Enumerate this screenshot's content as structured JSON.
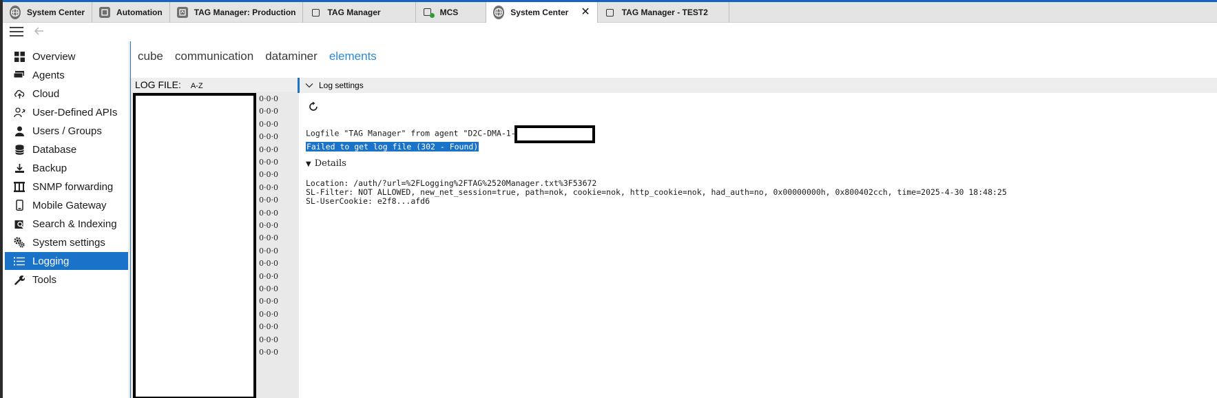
{
  "tabs": [
    {
      "label": "System Center",
      "icon": "globe-icon",
      "active": false
    },
    {
      "label": "Automation",
      "icon": "app-icon",
      "active": false
    },
    {
      "label": "TAG Manager: Production",
      "icon": "app-icon",
      "active": false
    },
    {
      "label": "TAG Manager",
      "icon": "square-icon",
      "active": false
    },
    {
      "label": "MCS",
      "icon": "square-status-icon",
      "active": false
    },
    {
      "label": "System Center",
      "icon": "globe-icon",
      "active": true
    },
    {
      "label": "TAG Manager - TEST2",
      "icon": "square-icon",
      "active": false
    }
  ],
  "tab_close_glyph": "✕",
  "sidebar": {
    "items": [
      {
        "label": "Overview",
        "icon": "grid-icon"
      },
      {
        "label": "Agents",
        "icon": "agents-icon"
      },
      {
        "label": "Cloud",
        "icon": "cloud-upload-icon"
      },
      {
        "label": "User-Defined APIs",
        "icon": "api-user-icon"
      },
      {
        "label": "Users / Groups",
        "icon": "user-icon"
      },
      {
        "label": "Database",
        "icon": "database-icon"
      },
      {
        "label": "Backup",
        "icon": "backup-icon"
      },
      {
        "label": "SNMP forwarding",
        "icon": "snmp-icon"
      },
      {
        "label": "Mobile Gateway",
        "icon": "mobile-icon"
      },
      {
        "label": "Search & Indexing",
        "icon": "search-index-icon"
      },
      {
        "label": "System settings",
        "icon": "gears-icon"
      },
      {
        "label": "Logging",
        "icon": "list-icon",
        "active": true
      },
      {
        "label": "Tools",
        "icon": "wrench-icon"
      }
    ]
  },
  "topnav": {
    "items": [
      "cube",
      "communication",
      "dataminer",
      "elements"
    ],
    "active": "elements"
  },
  "logfile": {
    "title": "LOG FILE:",
    "sort_label": "A-Z",
    "row_value": "0·0·0",
    "row_count": 21
  },
  "settings": {
    "header": "Log settings",
    "logfile_line": "Logfile \"TAG Manager\" from agent \"D2C-DMA-1-",
    "error": "Failed to get log file (302 - Found)",
    "details_label": "Details",
    "location": "Location: /auth/?url=%2FLogging%2FTAG%2520Manager.txt%3F53672",
    "sl_filter": "SL-Filter: NOT ALLOWED, new_net_session=true, path=nok, cookie=nok, http_cookie=nok, had_auth=no, 0x00000000h, 0x800402cch, time=2025-4-30 18:48:25",
    "sl_usercookie": "SL-UserCookie: e2f8...afd6"
  },
  "colors": {
    "accent": "#1a73c8",
    "active_link": "#2a89d3"
  }
}
